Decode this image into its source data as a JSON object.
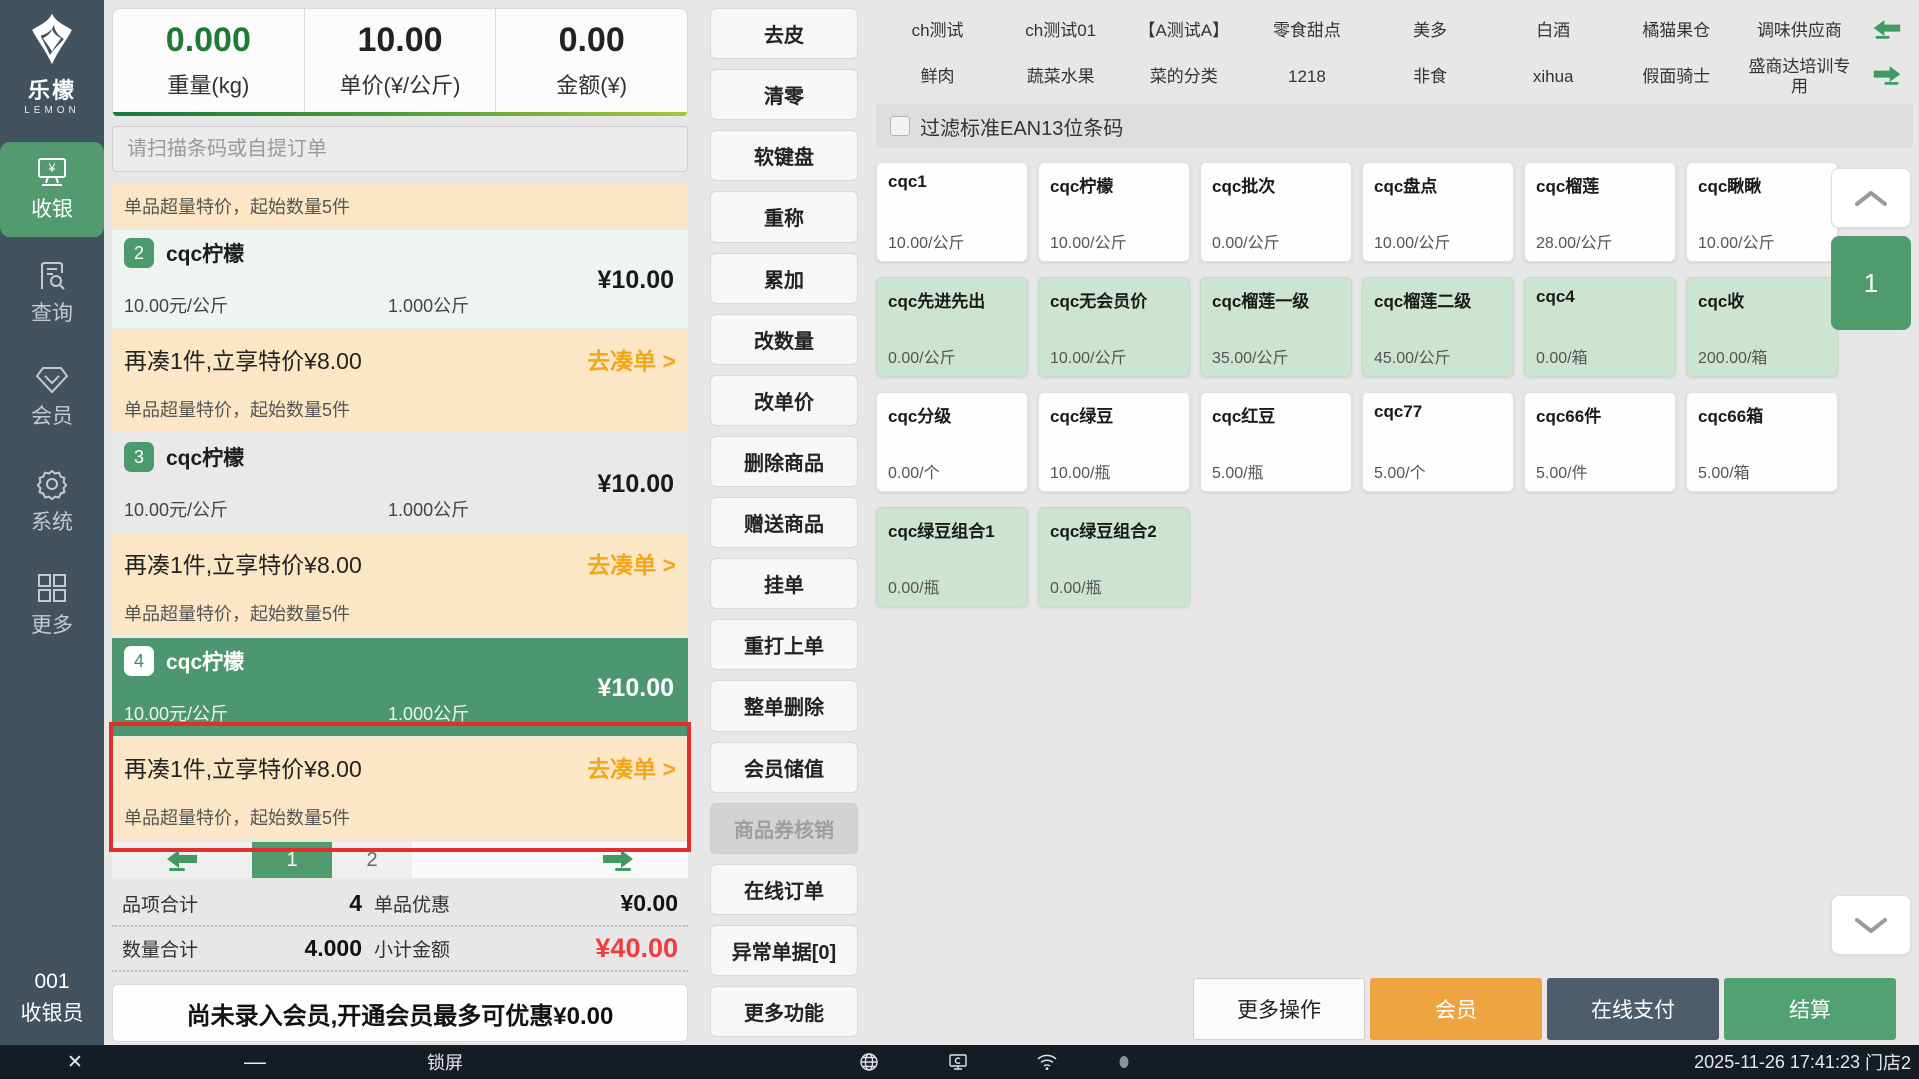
{
  "colors": {
    "accent_green": "#539a71",
    "selected_item_green": "#4c9770",
    "promo_bg": "#fbe7c6",
    "promo_action_orange": "#f0a818",
    "highlight_red": "#e02f2f",
    "subtotal_red": "#f43b3b",
    "member_btn_orange": "#efa53f",
    "online_pay_slate": "#4d5d6b",
    "sidebar_dark": "#42525e"
  },
  "sidebar": {
    "logo_text": "乐檬",
    "logo_sub": "LEMON",
    "items": [
      {
        "label": "收银",
        "active": true
      },
      {
        "label": "查询",
        "active": false
      },
      {
        "label": "会员",
        "active": false
      },
      {
        "label": "系统",
        "active": false
      },
      {
        "label": "更多",
        "active": false
      }
    ],
    "cashier_id": "001",
    "cashier_role": "收银员"
  },
  "scale": {
    "weight": "0.000",
    "weight_label": "重量(kg)",
    "price": "10.00",
    "price_label": "单价(¥/公斤)",
    "amount": "0.00",
    "amount_label": "金额(¥)"
  },
  "search": {
    "placeholder": "请扫描条码或自提订单"
  },
  "cart": {
    "top_banner": "单品超量特价，起始数量5件",
    "promo": {
      "line1": "再凑1件,立享特价¥8.00",
      "action": "去凑单 >",
      "line2": "单品超量特价，起始数量5件"
    },
    "items": [
      {
        "badge": "2",
        "name": "cqc柠檬",
        "price": "¥10.00",
        "unit": "10.00元/公斤",
        "qty": "1.000公斤"
      },
      {
        "badge": "3",
        "name": "cqc柠檬",
        "price": "¥10.00",
        "unit": "10.00元/公斤",
        "qty": "1.000公斤"
      },
      {
        "badge": "4",
        "name": "cqc柠檬",
        "price": "¥10.00",
        "unit": "10.00元/公斤",
        "qty": "1.000公斤"
      }
    ]
  },
  "pagination": {
    "pages": [
      "1",
      "2"
    ],
    "active": "1"
  },
  "totals": {
    "items_label": "品项合计",
    "items_value": "4",
    "discount_label": "单品优惠",
    "discount_value": "¥0.00",
    "qty_label": "数量合计",
    "qty_value": "4.000",
    "subtotal_label": "小计金额",
    "subtotal_value": "¥40.00"
  },
  "member_notice": "尚未录入会员,开通会员最多可优惠¥0.00",
  "fn_buttons": [
    "去皮",
    "清零",
    "软键盘",
    "重称",
    "累加",
    "改数量",
    "改单价",
    "删除商品",
    "赠送商品",
    "挂单",
    "重打上单",
    "整单删除",
    "会员储值",
    "商品券核销",
    "在线订单",
    "异常单据[0]",
    "更多功能"
  ],
  "categories": {
    "row1": [
      "ch测试",
      "ch测试01",
      "【A测试A】",
      "零食甜点",
      "美多",
      "白酒",
      "橘猫果仓",
      "调味供应商"
    ],
    "row2": [
      "鲜肉",
      "蔬菜水果",
      "菜的分类",
      "1218",
      "非食",
      "xihua",
      "假面骑士",
      "盛商达培训专用"
    ]
  },
  "filter": {
    "label": "过滤标准EAN13位条码",
    "checked": false
  },
  "products": [
    {
      "name": "cqc1",
      "price": "10.00/公斤"
    },
    {
      "name": "cqc柠檬",
      "price": "10.00/公斤"
    },
    {
      "name": "cqc批次",
      "price": "0.00/公斤"
    },
    {
      "name": "cqc盘点",
      "price": "10.00/公斤"
    },
    {
      "name": "cqc榴莲",
      "price": "28.00/公斤"
    },
    {
      "name": "cqc瞅瞅",
      "price": "10.00/公斤"
    },
    {
      "name": "cqc先进先出",
      "price": "0.00/公斤"
    },
    {
      "name": "cqc无会员价",
      "price": "10.00/公斤"
    },
    {
      "name": "cqc榴莲一级",
      "price": "35.00/公斤"
    },
    {
      "name": "cqc榴莲二级",
      "price": "45.00/公斤"
    },
    {
      "name": "cqc4",
      "price": "0.00/箱"
    },
    {
      "name": "cqc收",
      "price": "200.00/箱"
    },
    {
      "name": "cqc分级",
      "price": "0.00/个"
    },
    {
      "name": "cqc绿豆",
      "price": "10.00/瓶"
    },
    {
      "name": "cqc红豆",
      "price": "5.00/瓶"
    },
    {
      "name": "cqc77",
      "price": "5.00/个"
    },
    {
      "name": "cqc66件",
      "price": "5.00/件"
    },
    {
      "name": "cqc66箱",
      "price": "5.00/箱"
    },
    {
      "name": "cqc绿豆组合1",
      "price": "0.00/瓶"
    },
    {
      "name": "cqc绿豆组合2",
      "price": "0.00/瓶"
    }
  ],
  "pager": {
    "page": "1"
  },
  "actions": {
    "more": "更多操作",
    "member": "会员",
    "online_pay": "在线支付",
    "settle": "结算"
  },
  "statusbar": {
    "lock": "锁屏",
    "datetime": "2025-11-26 17:41:23",
    "store": "门店2"
  }
}
